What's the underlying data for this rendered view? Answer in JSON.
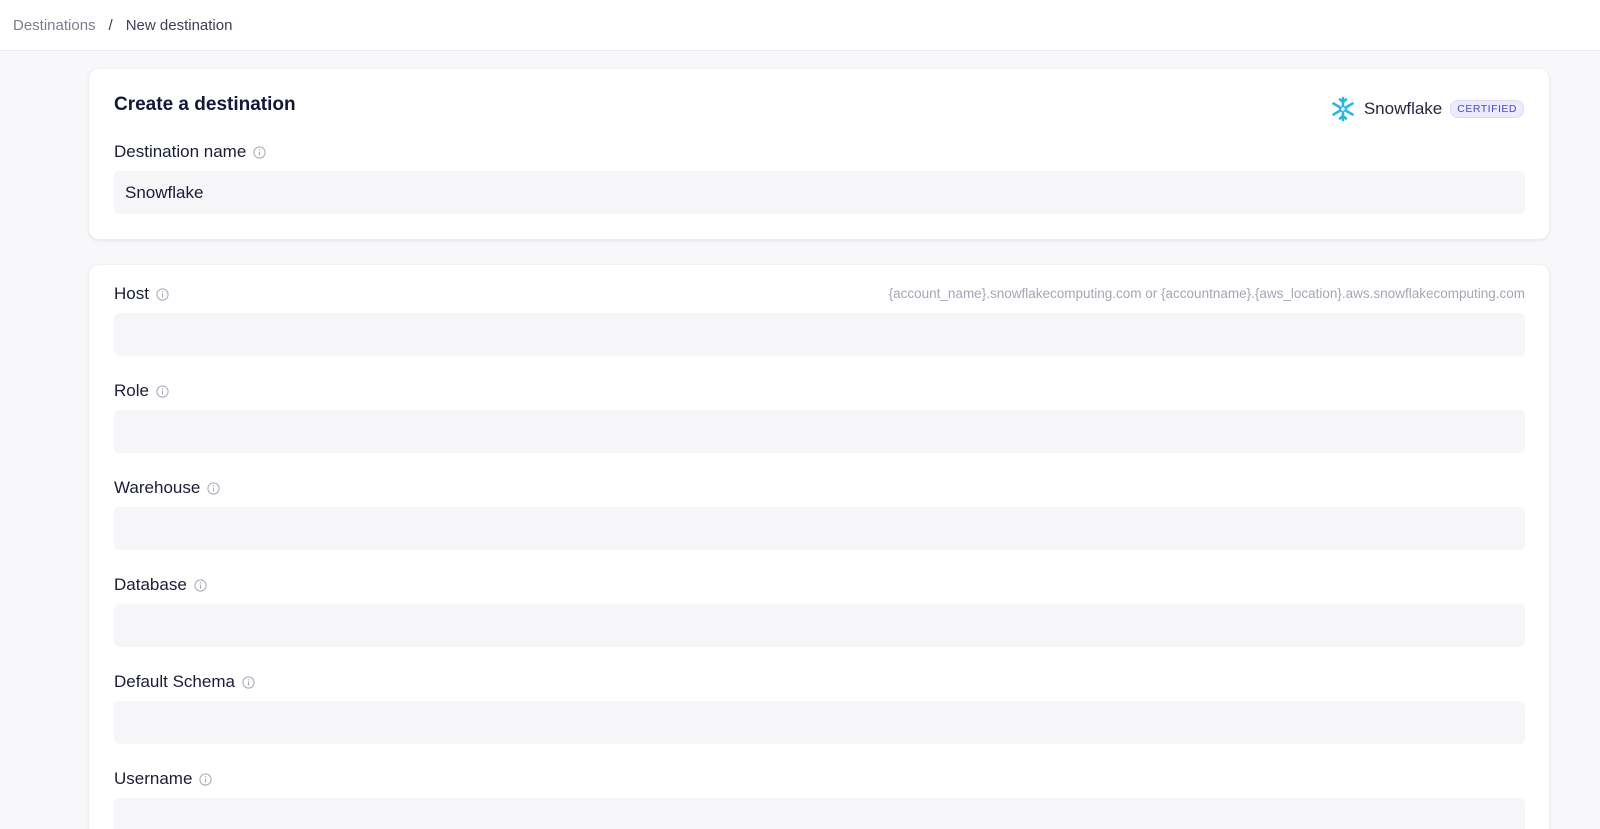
{
  "breadcrumb": {
    "parent": "Destinations",
    "separator": "/",
    "current": "New destination"
  },
  "header": {
    "title": "Create a destination",
    "vendor_name": "Snowflake",
    "vendor_badge": "CERTIFIED",
    "vendor_icon": "snowflake-logo-icon",
    "vendor_color": "#29b5e8"
  },
  "destination_name": {
    "label": "Destination name",
    "value": "Snowflake"
  },
  "fields": {
    "host": {
      "label": "Host",
      "hint": "{account_name}.snowflakecomputing.com or {accountname}.{aws_location}.aws.snowflakecomputing.com",
      "value": ""
    },
    "role": {
      "label": "Role",
      "value": ""
    },
    "warehouse": {
      "label": "Warehouse",
      "value": ""
    },
    "database": {
      "label": "Database",
      "value": ""
    },
    "default_schema": {
      "label": "Default Schema",
      "value": ""
    },
    "username": {
      "label": "Username",
      "value": ""
    }
  },
  "colors": {
    "page_background": "#f8f8fa",
    "badge_text": "#4f46c8",
    "badge_background": "#ecebfd",
    "input_background": "#f6f6f9"
  }
}
